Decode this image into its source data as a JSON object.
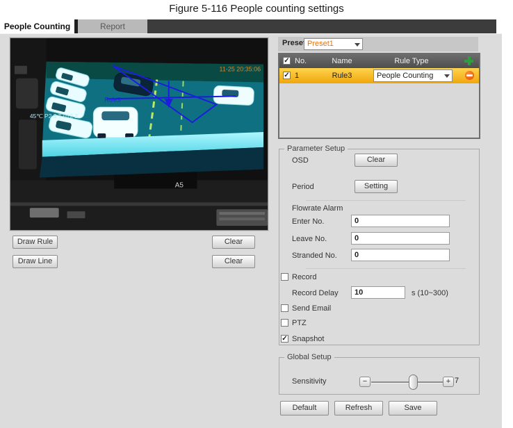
{
  "figure_caption": "Figure 5-116 People counting settings",
  "tabs": {
    "people_counting": "People Counting",
    "report": "Report"
  },
  "video": {
    "timestamp": "11-25 20:35:06",
    "osd_left": "45℃ P2 3 T 012 2",
    "rule_label": "Rule3",
    "marking": "A5"
  },
  "left_controls": {
    "draw_rule": "Draw Rule",
    "clear_rule": "Clear",
    "draw_line": "Draw Line",
    "clear_line": "Clear"
  },
  "preset": {
    "label": "Preset",
    "value": "Preset1"
  },
  "rule_table": {
    "columns": [
      "No.",
      "Name",
      "Rule Type"
    ],
    "row": {
      "checked": true,
      "no": "1",
      "name": "Rule3",
      "rule_type": "People Counting"
    }
  },
  "parameter_setup": {
    "legend": "Parameter Setup",
    "osd_label": "OSD",
    "osd_clear_button": "Clear",
    "period_label": "Period",
    "period_setting_button": "Setting",
    "flowrate_alarm_label": "Flowrate Alarm",
    "fields": [
      {
        "label": "Enter No.",
        "value": "0"
      },
      {
        "label": "Leave No.",
        "value": "0"
      },
      {
        "label": "Stranded No.",
        "value": "0"
      }
    ],
    "checkboxes": [
      {
        "label": "Record",
        "checked": false
      },
      {
        "label": "Send Email",
        "checked": false
      },
      {
        "label": "PTZ",
        "checked": false
      },
      {
        "label": "Snapshot",
        "checked": true
      }
    ],
    "record_delay": {
      "label": "Record Delay",
      "value": "10",
      "suffix": "s (10~300)"
    }
  },
  "global_setup": {
    "legend": "Global Setup",
    "sensitivity_label": "Sensitivity",
    "minus": "−",
    "plus": "+",
    "sensitivity_value": "7"
  },
  "footer_buttons": {
    "default": "Default",
    "refresh": "Refresh",
    "save": "Save"
  },
  "colors": {
    "selected_row_top": "#ffd44d",
    "selected_row_bottom": "#f0a60d",
    "preset_value_text": "#e07312",
    "rule_overlay_blue": "#1d1dde",
    "add_icon_green": "#2f9e3f",
    "delete_icon_orange": "#e2500a"
  }
}
